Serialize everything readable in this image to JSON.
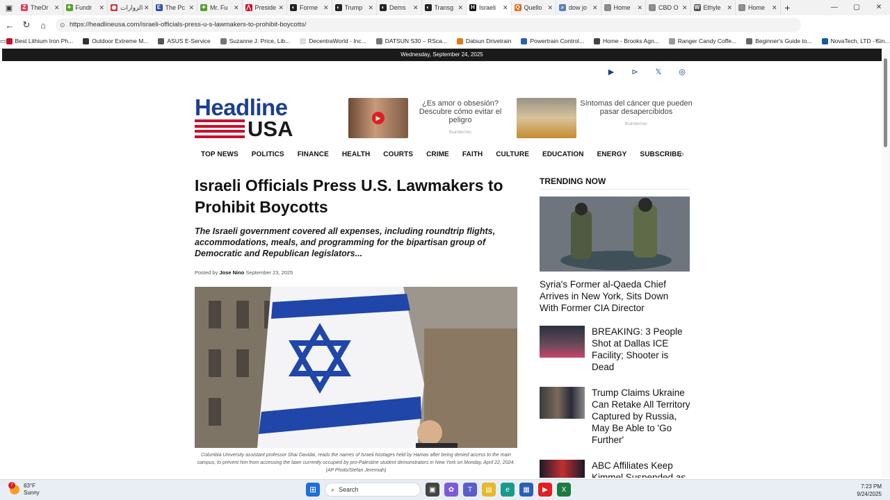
{
  "browser": {
    "tabs": [
      {
        "label": "TheOr",
        "fav": "Z",
        "color": "#e0405a"
      },
      {
        "label": "Fundr",
        "fav": "✦",
        "color": "#5a9e2f"
      },
      {
        "label": "الزوارات",
        "fav": "◉",
        "color": "#cc3333"
      },
      {
        "label": "The Pc",
        "fav": "E",
        "color": "#2b4fa0"
      },
      {
        "label": "Mr. Fu",
        "fav": "✦",
        "color": "#5a9e2f"
      },
      {
        "label": "Preside",
        "fav": "⋀",
        "color": "#c8102e"
      },
      {
        "label": "Forme",
        "fav": "◐",
        "color": "#222222"
      },
      {
        "label": "Trump",
        "fav": "◐",
        "color": "#222222"
      },
      {
        "label": "Dems",
        "fav": "◐",
        "color": "#222222"
      },
      {
        "label": "Transg",
        "fav": "◐",
        "color": "#222222"
      },
      {
        "label": "Israeli",
        "fav": "H",
        "color": "#111111",
        "active": true
      },
      {
        "label": "Quello",
        "fav": "Q",
        "color": "#e06a1a"
      },
      {
        "label": "dow jo",
        "fav": "⌕",
        "color": "#5a7fb5"
      },
      {
        "label": "Home",
        "fav": "◌",
        "color": "#888888"
      },
      {
        "label": "CBD O",
        "fav": "◌",
        "color": "#888888"
      },
      {
        "label": "Ethyle",
        "fav": "W",
        "color": "#555555"
      },
      {
        "label": "Home",
        "fav": "◌",
        "color": "#888888"
      }
    ],
    "new_tab": "+",
    "url": "https://headlineusa.com/israeli-officials-press-u-s-lawmakers-to-prohibit-boycotts/",
    "bookmarks": [
      {
        "label": "Best Lithium Iron Ph...",
        "color": "#c8102e"
      },
      {
        "label": "Outdoor Extreme M...",
        "color": "#333333"
      },
      {
        "label": "ASUS E-Service",
        "color": "#555555"
      },
      {
        "label": "Suzanne J. Price, Lib...",
        "color": "#777777"
      },
      {
        "label": "DecentraWorld - Inc...",
        "color": "#dddddd"
      },
      {
        "label": "DATSUN S30 – RSca...",
        "color": "#777777"
      },
      {
        "label": "Datsun Drivetrain",
        "color": "#e07a1a"
      },
      {
        "label": "Powertrain Control...",
        "color": "#2b5fb5"
      },
      {
        "label": "Home - Brooks Agn...",
        "color": "#444444"
      },
      {
        "label": "Ranger Candy Coffe...",
        "color": "#999999"
      },
      {
        "label": "Beginner's Guide to...",
        "color": "#666666"
      },
      {
        "label": "NovaTech, LTD - Sin...",
        "color": "#1a5a9e"
      }
    ]
  },
  "site": {
    "date": "Wednesday, September 24, 2025",
    "logo_top": "Headline",
    "logo_bottom": "USA",
    "ads": [
      {
        "text": "¿Es amor o obsesión? Descubre cómo evitar el peligro",
        "source": "Brainberries"
      },
      {
        "text": "Síntomas del cáncer que pueden pasar desapercibidos",
        "source": "Brainberries"
      }
    ],
    "nav": [
      "TOP NEWS",
      "POLITICS",
      "FINANCE",
      "HEALTH",
      "COURTS",
      "CRIME",
      "FAITH",
      "CULTURE",
      "EDUCATION",
      "ENERGY",
      "SUBSCRIBE"
    ]
  },
  "article": {
    "title": "Israeli Officials Press U.S. Lawmakers to Prohibit Boycotts",
    "dek": "The Israeli government covered all expenses, including roundtrip flights, accommodations, meals, and programming for the bipartisan group of Democratic and Republican legislators...",
    "posted_by": "Posted by",
    "author": "Jose Nino",
    "date": "September 23, 2025",
    "caption": "Columbia University assistant professor Shai Davidai, reads the names of Israeli hostages held by Hamas after being denied access to the main campus, to prevent him from accessing the lawn currently occupied by pro-Palestine student demonstrators in New York on Monday, April 22, 2024.  (AP Photo/Stefan Jeremiah)"
  },
  "trending": {
    "title": "TRENDING NOW",
    "featured": "Syria's Former al-Qaeda Chief Arrives in New York, Sits Down With Former CIA Director",
    "items": [
      {
        "text": "BREAKING: 3 People Shot at Dallas ICE Facility; Shooter is Dead"
      },
      {
        "text": "Trump Claims Ukraine Can Retake All Territory Captured by Russia, May Be Able to 'Go Further'"
      },
      {
        "text": "ABC Affiliates Keep Kimmel Suspended as"
      }
    ]
  },
  "taskbar": {
    "temp": "83°F",
    "condition": "Sunny",
    "badge": "7",
    "search": "Search",
    "time": "7:23 PM",
    "date": "9/24/2025"
  }
}
